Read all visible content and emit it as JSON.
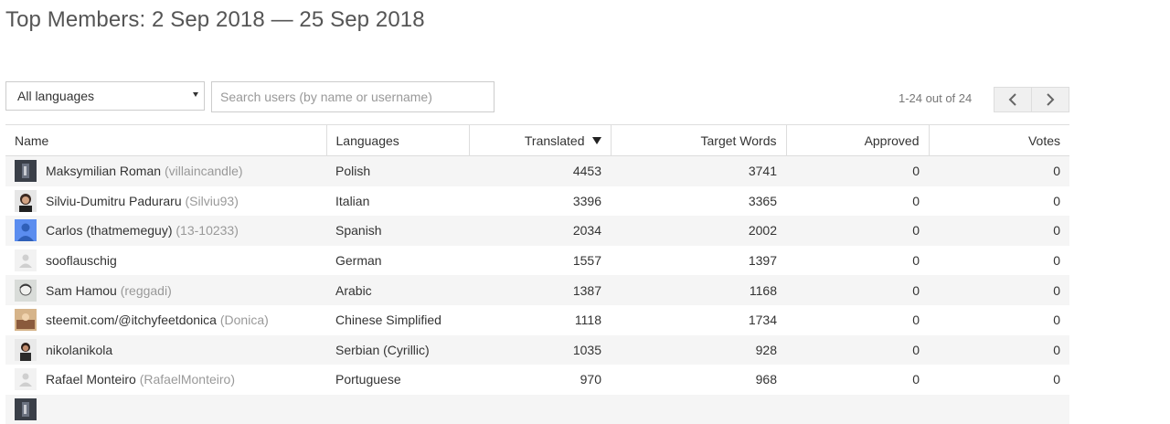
{
  "title": "Top Members: 2 Sep 2018 — 25 Sep 2018",
  "filters": {
    "language_select": "All languages",
    "search_placeholder": "Search users (by name or username)"
  },
  "pagination": {
    "info": "1-24 out of 24"
  },
  "table": {
    "headers": {
      "name": "Name",
      "languages": "Languages",
      "translated": "Translated",
      "target_words": "Target Words",
      "approved": "Approved",
      "votes": "Votes"
    },
    "rows": [
      {
        "name": "Maksymilian Roman",
        "username": "(villaincandle)",
        "language": "Polish",
        "translated": "4453",
        "target_words": "3741",
        "approved": "0",
        "votes": "0",
        "avatar": "photo-dark"
      },
      {
        "name": "Silviu-Dumitru Paduraru",
        "username": "(Silviu93)",
        "language": "Italian",
        "translated": "3396",
        "target_words": "3365",
        "approved": "0",
        "votes": "0",
        "avatar": "photo-person"
      },
      {
        "name": "Carlos (thatmemeguy)",
        "username": "(13-10233)",
        "language": "Spanish",
        "translated": "2034",
        "target_words": "2002",
        "approved": "0",
        "votes": "0",
        "avatar": "default-blue"
      },
      {
        "name": "sooflauschig",
        "username": "",
        "language": "German",
        "translated": "1557",
        "target_words": "1397",
        "approved": "0",
        "votes": "0",
        "avatar": "default-gray"
      },
      {
        "name": "Sam Hamou",
        "username": "(reggadi)",
        "language": "Arabic",
        "translated": "1387",
        "target_words": "1168",
        "approved": "0",
        "votes": "0",
        "avatar": "photo-sketch"
      },
      {
        "name": "steemit.com/@itchyfeetdonica",
        "username": "(Donica)",
        "language": "Chinese Simplified",
        "translated": "1118",
        "target_words": "1734",
        "approved": "0",
        "votes": "0",
        "avatar": "photo-warm"
      },
      {
        "name": "nikolanikola",
        "username": "",
        "language": "Serbian (Cyrillic)",
        "translated": "1035",
        "target_words": "928",
        "approved": "0",
        "votes": "0",
        "avatar": "photo-man"
      },
      {
        "name": "Rafael Monteiro",
        "username": "(RafaelMonteiro)",
        "language": "Portuguese",
        "translated": "970",
        "target_words": "968",
        "approved": "0",
        "votes": "0",
        "avatar": "default-gray"
      },
      {
        "name": "",
        "username": "",
        "language": "",
        "translated": "",
        "target_words": "",
        "approved": "",
        "votes": "",
        "avatar": "photo-dark"
      }
    ]
  }
}
